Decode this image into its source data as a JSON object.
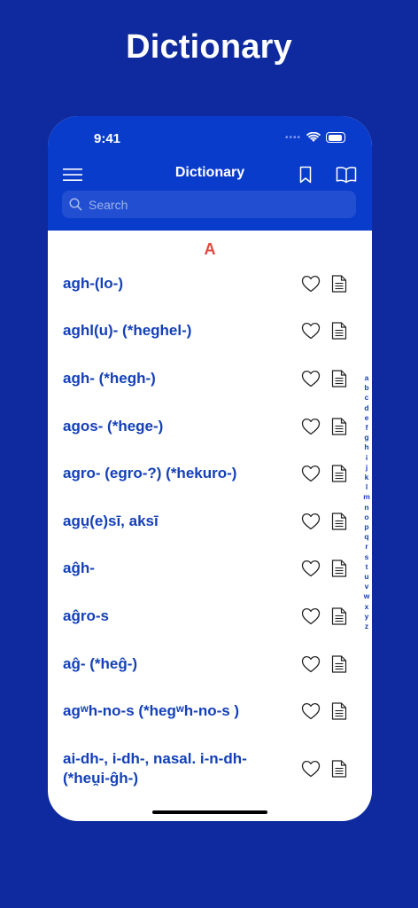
{
  "page": {
    "title": "Dictionary"
  },
  "status_bar": {
    "time": "9:41"
  },
  "navbar": {
    "title": "Dictionary"
  },
  "search": {
    "placeholder": "Search"
  },
  "section": {
    "letter": "A"
  },
  "entries": [
    {
      "term": "agh-(lo-)"
    },
    {
      "term": "aghl(u)- (*heghel-)"
    },
    {
      "term": "agh- (*hegh-)"
    },
    {
      "term": "agos- (*hege-)"
    },
    {
      "term": "agro- (egro-?) (*hekuro-)"
    },
    {
      "term": "agu̯(e)sī, aksī"
    },
    {
      "term": "aĝh-"
    },
    {
      "term": "aĝro-s"
    },
    {
      "term": "aĝ- (*heĝ-)"
    },
    {
      "term": "agʷh-no-s (*hegʷh-no-s )"
    },
    {
      "term": "ai-dh-, i-dh-, nasal. i-n-dh- (*heu̯i-ĝh-)"
    }
  ],
  "alphabet_index": [
    "a",
    "b",
    "c",
    "d",
    "e",
    "f",
    "g",
    "h",
    "i",
    "j",
    "k",
    "l",
    "m",
    "n",
    "o",
    "p",
    "q",
    "r",
    "s",
    "t",
    "u",
    "v",
    "w",
    "x",
    "y",
    "z"
  ],
  "colors": {
    "background": "#0e2a9e",
    "header": "#0a3ccc",
    "entry_text": "#1440b8",
    "section_letter": "#e0493c"
  },
  "icons": {
    "menu": "hamburger-icon",
    "bookmark": "bookmark-icon",
    "book": "open-book-icon",
    "favorite": "heart-icon",
    "details": "document-icon"
  }
}
